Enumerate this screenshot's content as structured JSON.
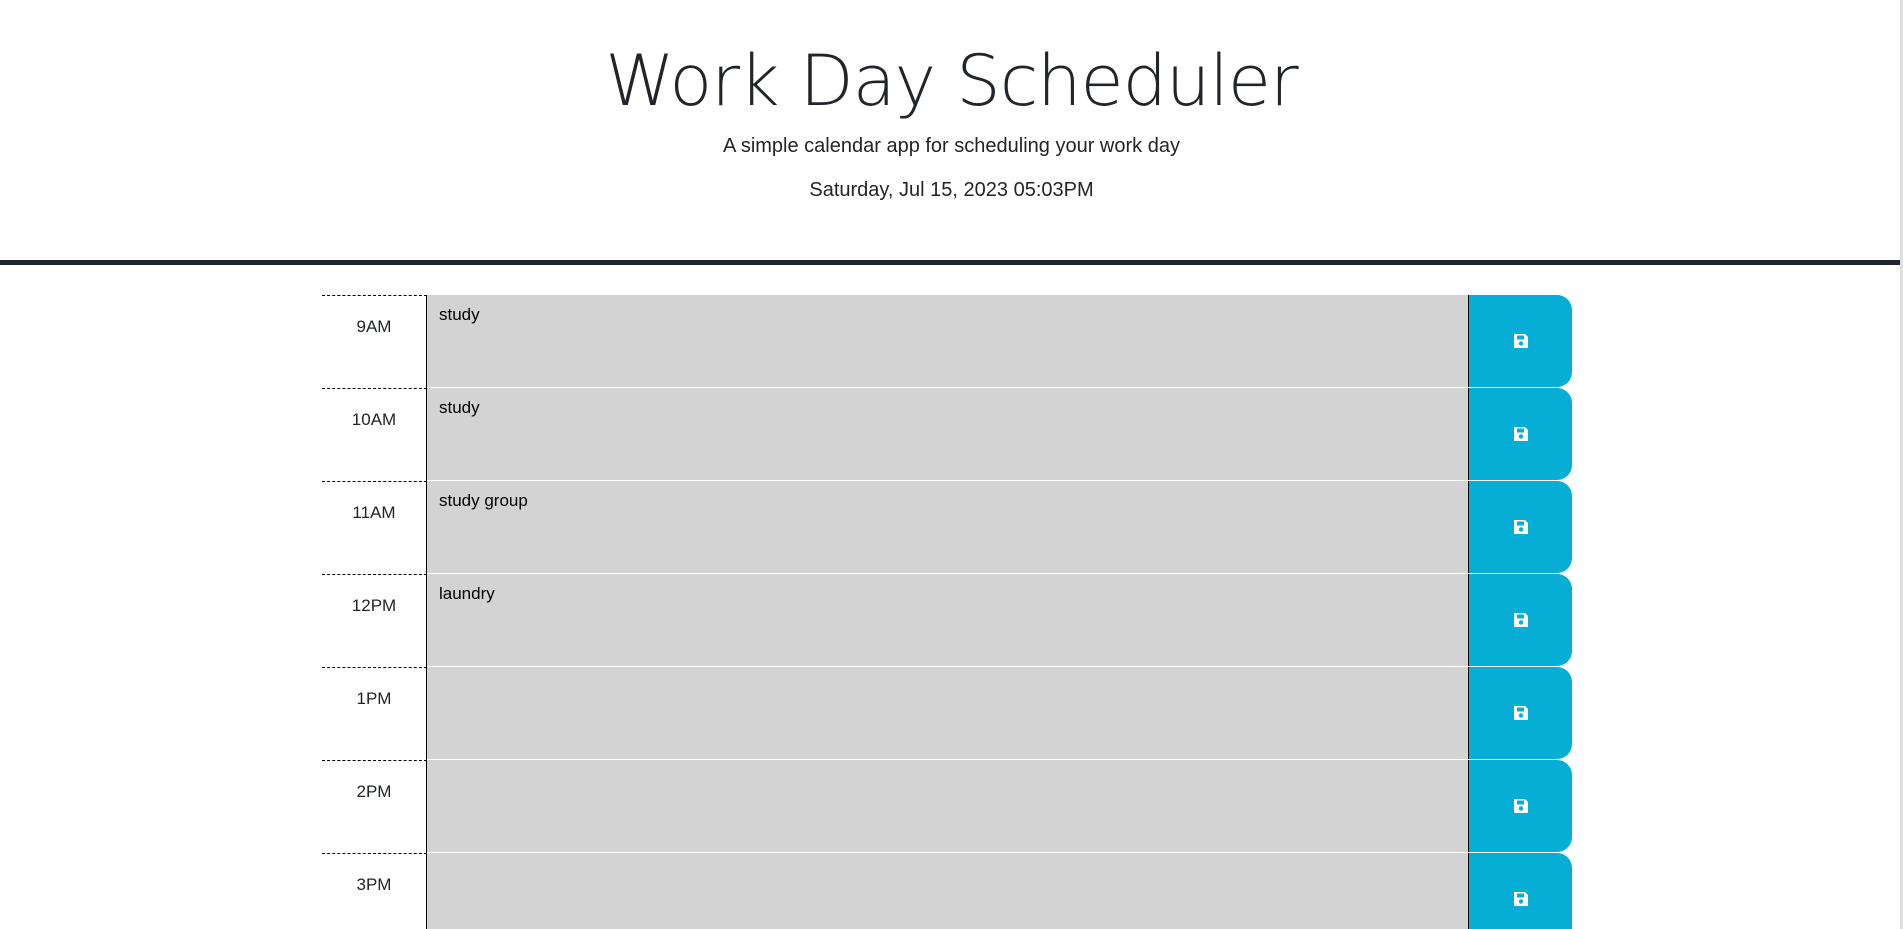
{
  "header": {
    "title": "Work Day Scheduler",
    "lead": "A simple calendar app for scheduling your work day",
    "current_day": "Saturday, Jul 15, 2023 05:03PM"
  },
  "colors": {
    "past_block": "#d3d3d3",
    "save_button": "#06aed5",
    "header_rule": "#212529"
  },
  "icons": {
    "save": "floppy-disk-icon"
  },
  "time_blocks": [
    {
      "hour": "9AM",
      "text": "study"
    },
    {
      "hour": "10AM",
      "text": "study"
    },
    {
      "hour": "11AM",
      "text": "study group"
    },
    {
      "hour": "12PM",
      "text": "laundry"
    },
    {
      "hour": "1PM",
      "text": ""
    },
    {
      "hour": "2PM",
      "text": ""
    },
    {
      "hour": "3PM",
      "text": ""
    }
  ]
}
